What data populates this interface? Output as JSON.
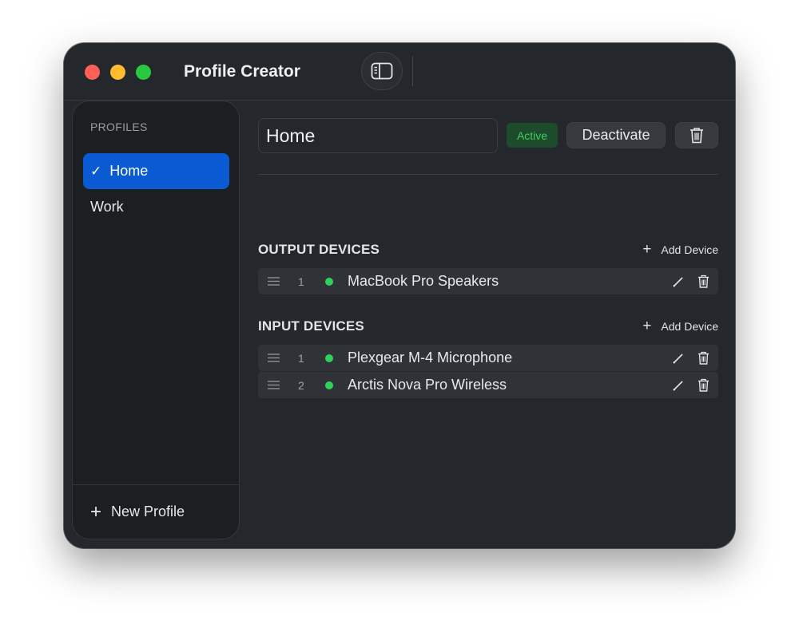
{
  "app": {
    "title": "Profile Creator"
  },
  "icons": {
    "sidebar_toggle": "sidebar-toggle-icon",
    "check": "checkmark-icon",
    "plus": "plus-icon",
    "trash": "trash-icon",
    "pencil": "pencil-icon",
    "drag": "drag-handle-icon"
  },
  "colors": {
    "accent": "#0a5bd3",
    "active_badge_bg": "#1e4b2b",
    "active_badge_text": "#3fcf63",
    "status_dot": "#30d158"
  },
  "sidebar": {
    "heading": "PROFILES",
    "items": [
      {
        "label": "Home",
        "selected": true,
        "check": "✓"
      },
      {
        "label": "Work",
        "selected": false
      }
    ],
    "new_profile_label": "New Profile"
  },
  "profile": {
    "name": "Home",
    "status": "Active",
    "deactivate_label": "Deactivate"
  },
  "output": {
    "title": "OUTPUT DEVICES",
    "add_label": "Add Device",
    "devices": [
      {
        "index": "1",
        "name": "MacBook Pro Speakers",
        "connected": true
      }
    ]
  },
  "input": {
    "title": "INPUT DEVICES",
    "add_label": "Add Device",
    "devices": [
      {
        "index": "1",
        "name": "Plexgear M-4 Microphone",
        "connected": true
      },
      {
        "index": "2",
        "name": "Arctis Nova Pro Wireless",
        "connected": true
      }
    ]
  }
}
